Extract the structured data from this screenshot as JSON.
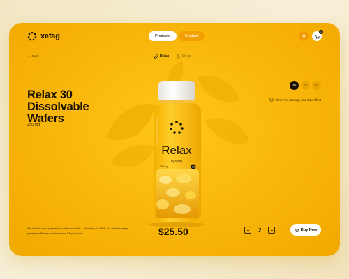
{
  "brand": {
    "name": "xefag"
  },
  "nav": {
    "items": [
      "Products",
      "Contact"
    ]
  },
  "cart": {
    "count": "0"
  },
  "back": {
    "label": "Back"
  },
  "variants": [
    {
      "label": "Relax",
      "active": true
    },
    {
      "label": "Sleep",
      "active": false
    }
  ],
  "product": {
    "title": "Relax 30 Dissolvable Wafers",
    "dose": "250 mg",
    "label_name": "Relax",
    "label_by": "by Xefag",
    "label_dose": "250 mg",
    "label_count": "30",
    "counts": [
      "30",
      "60",
      "90"
    ],
    "selected_count": "30",
    "info": "Overview, Dosage and Side effect",
    "description": "We work in close partnership with our clients – including the NHS, the military, major private healthcare providers and GP practices.",
    "price": "$25.50",
    "quantity": "2"
  },
  "buy": {
    "label": "Buy Now"
  },
  "colors": {
    "accent": "#f9b509",
    "dark": "#1a1200",
    "white": "#ffffff"
  }
}
